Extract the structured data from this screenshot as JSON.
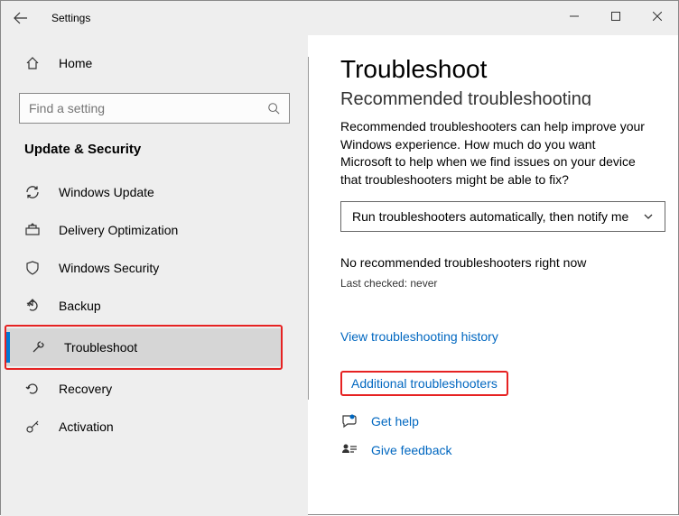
{
  "app": {
    "title": "Settings"
  },
  "sidebar": {
    "home_label": "Home",
    "search_placeholder": "Find a setting",
    "section_label": "Update & Security",
    "items": [
      {
        "label": "Windows Update"
      },
      {
        "label": "Delivery Optimization"
      },
      {
        "label": "Windows Security"
      },
      {
        "label": "Backup"
      },
      {
        "label": "Troubleshoot"
      },
      {
        "label": "Recovery"
      },
      {
        "label": "Activation"
      }
    ]
  },
  "main": {
    "title": "Troubleshoot",
    "subheading": "Recommended troubleshooting",
    "description": "Recommended troubleshooters can help improve your Windows experience. How much do you want Microsoft to help when we find issues on your device that troubleshooters might be able to fix?",
    "dropdown_value": "Run troubleshooters automatically, then notify me",
    "no_recommended": "No recommended troubleshooters right now",
    "last_checked": "Last checked: never",
    "view_history": "View troubleshooting history",
    "additional": "Additional troubleshooters",
    "get_help": "Get help",
    "give_feedback": "Give feedback"
  }
}
